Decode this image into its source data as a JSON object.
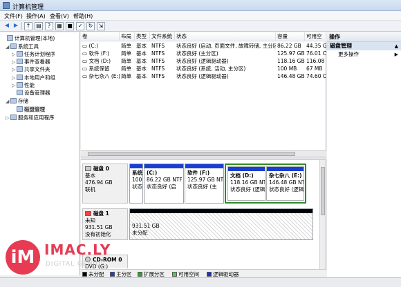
{
  "window": {
    "title": "计算机管理"
  },
  "menu": [
    "文件(F)",
    "操作(A)",
    "查看(V)",
    "帮助(H)"
  ],
  "tree": [
    {
      "label": "计算机管理(本地)",
      "icon": "computer-icon",
      "exp": ""
    },
    {
      "label": "系统工具",
      "icon": "tools-icon",
      "exp": "◢"
    },
    {
      "label": "任务计划程序",
      "icon": "clock-icon",
      "exp": "▷"
    },
    {
      "label": "事件查看器",
      "icon": "event-icon",
      "exp": "▷"
    },
    {
      "label": "共享文件夹",
      "icon": "folder-icon",
      "exp": "▷"
    },
    {
      "label": "本地用户和组",
      "icon": "users-icon",
      "exp": "▷"
    },
    {
      "label": "性能",
      "icon": "performance-icon",
      "exp": "▷"
    },
    {
      "label": "设备管理器",
      "icon": "device-icon",
      "exp": ""
    },
    {
      "label": "存储",
      "icon": "storage-icon",
      "exp": "◢"
    },
    {
      "label": "磁盘管理",
      "icon": "disk-icon",
      "exp": ""
    },
    {
      "label": "服务和应用程序",
      "icon": "services-icon",
      "exp": "▷"
    }
  ],
  "volume_table": {
    "headers": [
      "卷",
      "布局",
      "类型",
      "文件系统",
      "状态",
      "容量",
      "可用空"
    ],
    "rows": [
      [
        "(C:)",
        "简单",
        "基本",
        "NTFS",
        "状态良好 (启动, 页面文件, 故障转储, 主分区)",
        "86.22 GB",
        "44.35 G"
      ],
      [
        "软件 (F:)",
        "简单",
        "基本",
        "NTFS",
        "状态良好 (主分区)",
        "125.97 GB",
        "76.01 C"
      ],
      [
        "文档 (D:)",
        "简单",
        "基本",
        "NTFS",
        "状态良好 (逻辑驱动器)",
        "118.16 GB",
        "116.08 C"
      ],
      [
        "系统保留",
        "简单",
        "基本",
        "NTFS",
        "状态良好 (系统, 活动, 主分区)",
        "100 MB",
        "67 MB"
      ],
      [
        "杂七杂八 (E:)",
        "简单",
        "基本",
        "NTFS",
        "状态良好 (逻辑驱动器)",
        "146.48 GB",
        "74.60 C"
      ]
    ]
  },
  "disks": {
    "disk0": {
      "name": "磁盘 0",
      "lines": [
        "基本",
        "476.94 GB",
        "联机"
      ],
      "partitions": [
        {
          "l1": "系统",
          "l2": "100",
          "l3": "状态"
        },
        {
          "l1": "(C:)",
          "l2": "86.22 GB NTF",
          "l3": "状态良好 (启"
        },
        {
          "l1": "软件  (F:)",
          "l2": "125.97 GB NTI",
          "l3": "状态良好 (主"
        },
        {
          "l1": "文档  (D:)",
          "l2": "118.16 GB NT",
          "l3": "状态良好 (逻辑"
        },
        {
          "l1": "杂七杂八  (E:)",
          "l2": "146.48 GB NT",
          "l3": "状态良好 (逻辑"
        }
      ]
    },
    "disk1": {
      "name": "磁盘 1",
      "lines": [
        "未知",
        "931.51 GB",
        "没有初始化"
      ],
      "partition": {
        "l1": "931.51 GB",
        "l2": "未分配"
      }
    },
    "cdrom": {
      "name": "CD-ROM 0",
      "line": "DVD (G:)"
    }
  },
  "legend": [
    {
      "label": "未分配",
      "color": "#000000"
    },
    {
      "label": "主分区",
      "color": "#1a3fd0"
    },
    {
      "label": "扩展分区",
      "color": "#2aa52a"
    },
    {
      "label": "可用空间",
      "color": "#4ad04a"
    },
    {
      "label": "逻辑驱动器",
      "color": "#2030c0"
    }
  ],
  "actions": {
    "header": "操作",
    "section": "磁盘管理",
    "more": "更多操作"
  },
  "watermark": {
    "mark": "iM",
    "brand": "IMAC.LY",
    "sub": "DIGITAL GENIUS"
  }
}
